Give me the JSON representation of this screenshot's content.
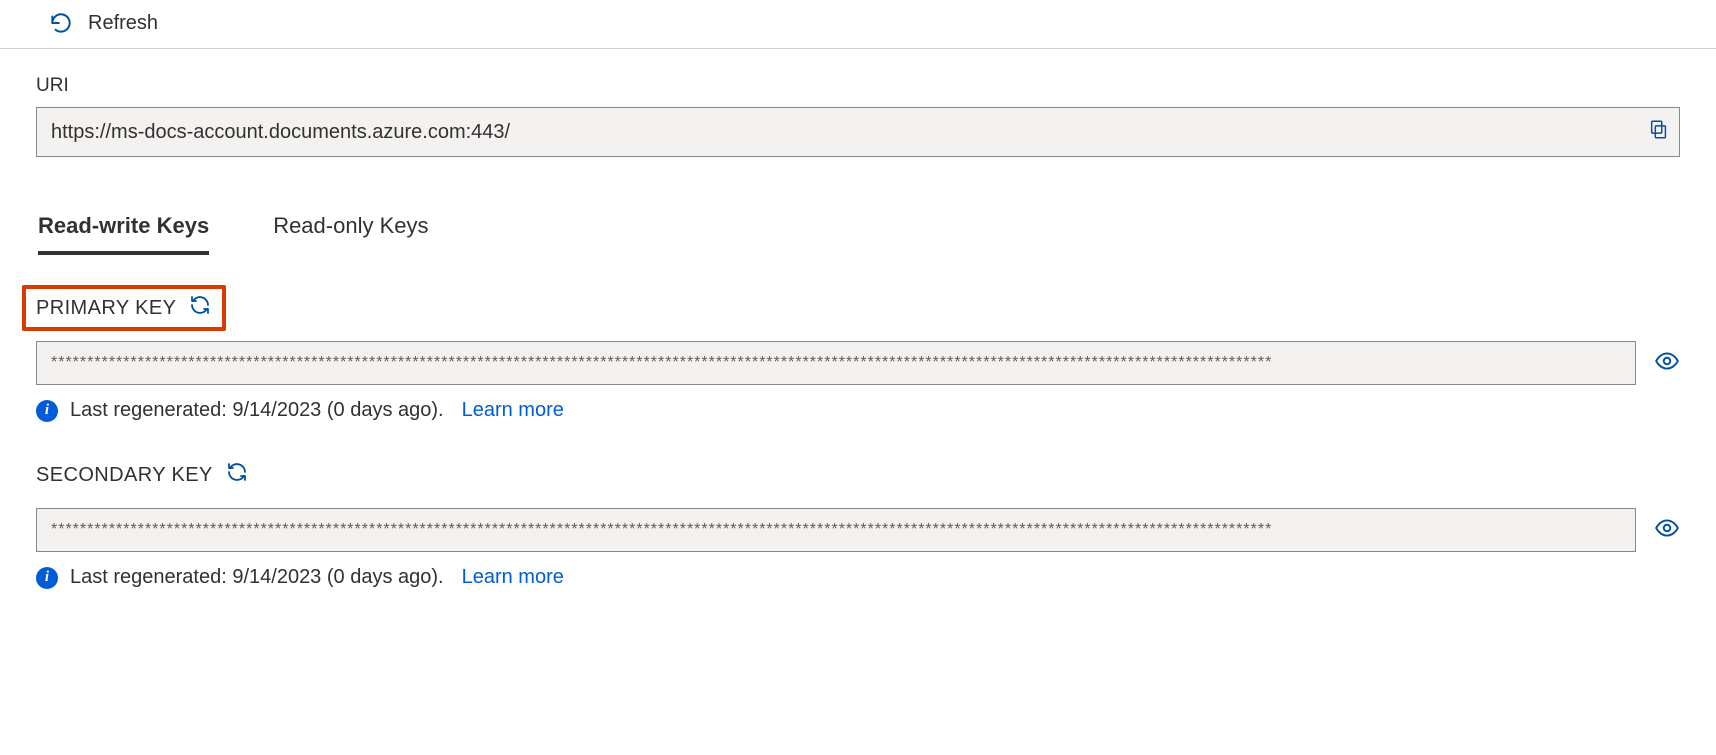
{
  "toolbar": {
    "refresh_label": "Refresh"
  },
  "uri": {
    "label": "URI",
    "value": "https://ms-docs-account.documents.azure.com:443/"
  },
  "tabs": {
    "read_write": "Read-write Keys",
    "read_only": "Read-only Keys"
  },
  "primary": {
    "label": "PRIMARY KEY",
    "masked_value": "*************************************************************************************************************************************************************************",
    "info_text": "Last regenerated: 9/14/2023 (0 days ago).",
    "learn_more": "Learn more"
  },
  "secondary": {
    "label": "SECONDARY KEY",
    "masked_value": "*************************************************************************************************************************************************************************",
    "info_text": "Last regenerated: 9/14/2023 (0 days ago).",
    "learn_more": "Learn more"
  }
}
